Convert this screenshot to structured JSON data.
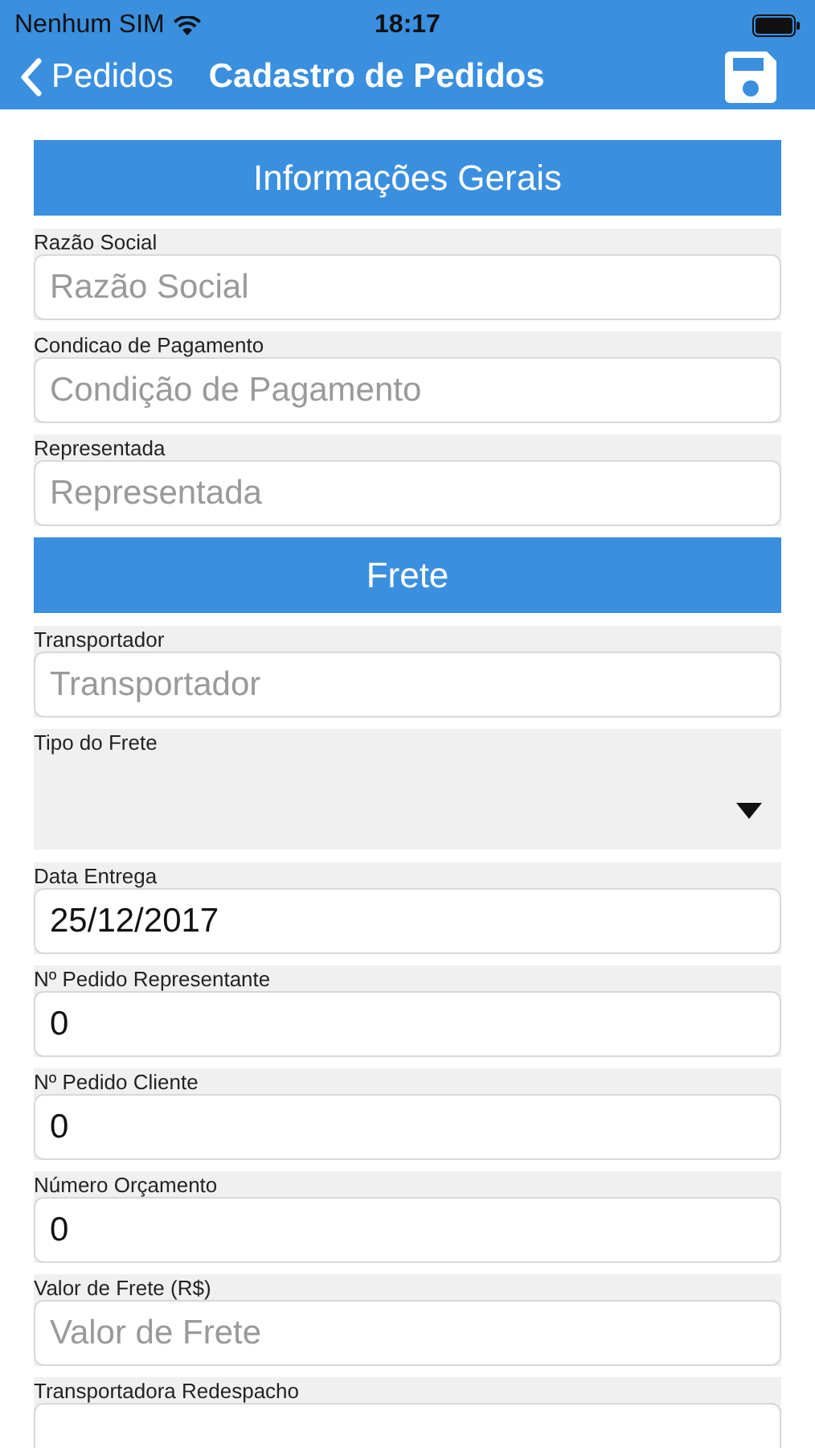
{
  "status_bar": {
    "carrier": "Nenhum SIM",
    "time": "18:17"
  },
  "nav": {
    "back": "Pedidos",
    "title": "Cadastro de Pedidos"
  },
  "sections": [
    {
      "title": "Informações Gerais",
      "fields": [
        {
          "kind": "text",
          "label": "Razão Social",
          "placeholder": "Razão Social"
        },
        {
          "kind": "text",
          "label": "Condicao de Pagamento",
          "placeholder": "Condição de Pagamento"
        },
        {
          "kind": "text",
          "label": "Representada",
          "placeholder": "Representada"
        }
      ]
    },
    {
      "title": "Frete",
      "fields": [
        {
          "kind": "text",
          "label": "Transportador",
          "placeholder": "Transportador"
        },
        {
          "kind": "select",
          "label": "Tipo do Frete"
        },
        {
          "kind": "text",
          "label": "Data Entrega",
          "value": "25/12/2017"
        },
        {
          "kind": "text",
          "label": "Nº Pedido Representante",
          "value": "0"
        },
        {
          "kind": "text",
          "label": "Nº Pedido Cliente",
          "value": "0"
        },
        {
          "kind": "text",
          "label": "Número Orçamento",
          "value": "0"
        },
        {
          "kind": "text",
          "label": "Valor de Frete (R$)",
          "placeholder": "Valor de Frete"
        },
        {
          "kind": "text",
          "label": "Transportadora Redespacho"
        }
      ]
    }
  ]
}
